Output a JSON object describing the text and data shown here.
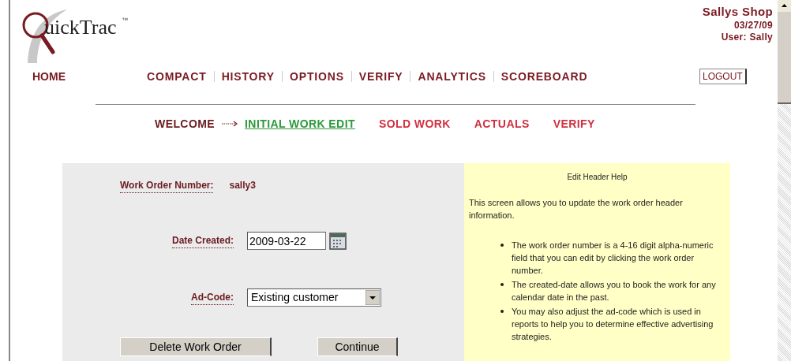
{
  "logo": {
    "text": "uickTrac",
    "mark": "™"
  },
  "shop": {
    "name": "Sallys Shop",
    "date": "03/27/09",
    "user": "User: Sally"
  },
  "home": "HOME",
  "nav": [
    "COMPACT",
    "HISTORY",
    "OPTIONS",
    "VERIFY",
    "ANALYTICS",
    "SCOREBOARD"
  ],
  "logout": "LOGOUT",
  "steps": [
    {
      "label": "WELCOME",
      "visited": true,
      "selected": false
    },
    {
      "label": "INITIAL WORK EDIT",
      "selected": true
    },
    {
      "label": "SOLD WORK",
      "visited": false,
      "selected": false
    },
    {
      "label": "ACTUALS",
      "visited": false,
      "selected": false
    },
    {
      "label": "VERIFY",
      "visited": false,
      "selected": false
    }
  ],
  "form": {
    "work_order_label": "Work Order Number:",
    "work_order_value": "sally3",
    "date_label": "Date Created:",
    "date_value": "2009-03-22",
    "adcode_label": "Ad-Code:",
    "adcode_value": "Existing customer",
    "buttons": [
      "Delete Work Order",
      "Continue"
    ]
  },
  "help": {
    "title": "Edit Header Help",
    "intro": "This screen allows you to update the work order header information.",
    "bullets": [
      "The work order number is a 4-16 digit alpha-numeric field that you can edit by clicking the work order number.",
      "The created-date allows you to book the work for any calendar date in the past.",
      "You may also adjust the ad-code which is used in reports to help you to determine effective advertising strategies."
    ]
  }
}
